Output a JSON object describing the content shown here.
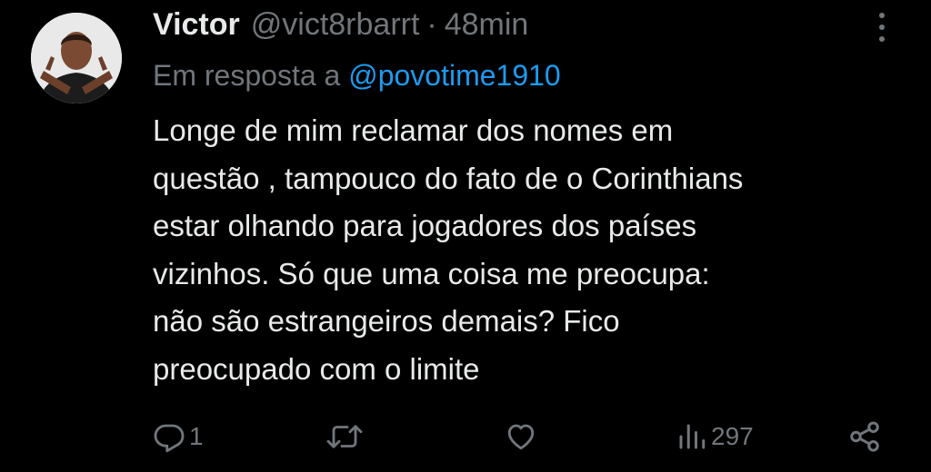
{
  "tweet": {
    "author": {
      "display_name": "Victor",
      "handle": "@vict8rbarrt",
      "separator": "·",
      "time": "48min"
    },
    "reply": {
      "prefix": "Em resposta a ",
      "mention": "@povotime1910"
    },
    "body_lines": [
      "Longe de mim reclamar dos nomes em",
      "questão , tampouco do fato de o Corinthians",
      "estar olhando para jogadores dos países",
      "vizinhos. Só que uma coisa me preocupa:",
      "não são estrangeiros demais? Fico",
      "preocupado com o limite"
    ]
  },
  "actions": {
    "reply": {
      "icon": "reply-icon",
      "count": "1"
    },
    "retweet": {
      "icon": "retweet-icon",
      "count": ""
    },
    "like": {
      "icon": "heart-icon",
      "count": ""
    },
    "views": {
      "icon": "views-icon",
      "count": "297"
    },
    "share": {
      "icon": "share-icon"
    }
  },
  "colors": {
    "background": "#000000",
    "text": "#e7e9ea",
    "muted": "#71767b",
    "link": "#1d9bf0"
  }
}
